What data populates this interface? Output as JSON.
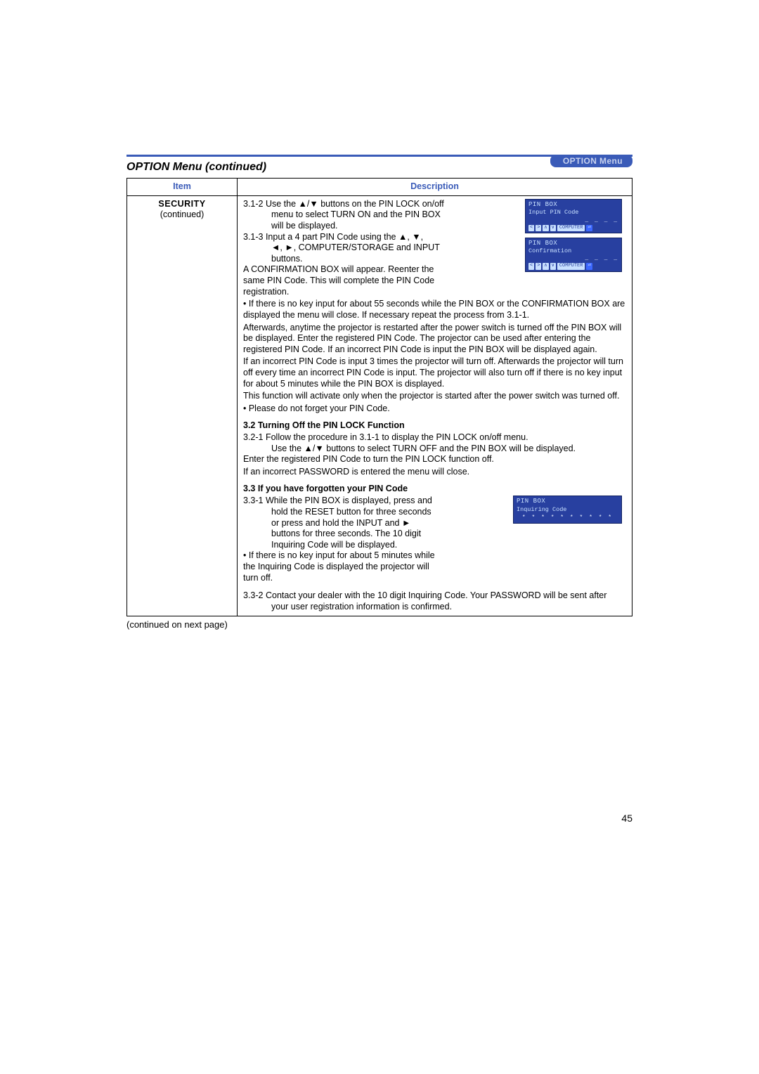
{
  "header": {
    "breadcrumb": "OPTION Menu"
  },
  "section_title": "OPTION Menu (continued)",
  "table": {
    "head_item": "Item",
    "head_desc": "Description",
    "item_name": "SECURITY",
    "item_sub": "(continued)"
  },
  "desc": {
    "l312a": "3.1-2  Use the ▲/▼ buttons on the PIN LOCK on/off",
    "l312b": "menu to select TURN ON and the PIN BOX will be displayed.",
    "l313a": "3.1-3  Input a 4 part PIN Code using the ▲, ▼,",
    "l313b": "◄, ►, COMPUTER/STORAGE and INPUT buttons.",
    "conf1": "A CONFIRMATION BOX will appear. Reenter the same PIN Code. This will complete the PIN Code registration.",
    "bul1": "• If there is no key input for about 55 seconds while the PIN BOX or the CONFIRMATION BOX are displayed the menu will close. If necessary repeat the process from 3.1-1.",
    "after": "Afterwards, anytime the projector is restarted after the power switch is turned off the PIN BOX will be displayed. Enter the registered PIN Code. The projector can be used after entering the registered PIN Code. If an incorrect PIN Code is input the PIN BOX will be displayed again.",
    "incorrect": "If an incorrect PIN Code is input 3 times the projector will turn off. Afterwards the projector will turn off every time an incorrect PIN Code is input. The projector will also turn off if there is no key input for about 5 minutes while the PIN BOX is displayed.",
    "activate": "This function will activate only when the projector is started after the power switch was turned off.",
    "forget": "• Please do not forget your PIN Code.",
    "h32": "3.2 Turning Off the PIN LOCK Function",
    "l321a": "3.2-1  Follow the procedure in 3.1-1 to display the PIN LOCK on/off menu.",
    "l321b": "Use the ▲/▼ buttons to select TURN OFF and the PIN BOX will be displayed.",
    "enter_off": "Enter the registered PIN Code to turn the PIN LOCK function off.",
    "wrong_pw": "If an incorrect PASSWORD is entered the menu will close.",
    "h33": "3.3 If you have forgotten your PIN Code",
    "l331a": "3.3-1  While the PIN BOX is displayed, press and",
    "l331b": "hold the RESET button for three seconds or press and hold the INPUT and ► buttons for three seconds. The 10 digit Inquiring Code will be displayed.",
    "bul33": "• If there is no key input for about 5 minutes while the Inquiring Code is displayed the projector will turn off.",
    "l332": "3.3-2  Contact your dealer with the 10 digit Inquiring Code. Your PASSWORD will be sent after your user registration information is confirmed."
  },
  "fig": {
    "pin_title": "PIN BOX",
    "pin_sub": "Input PIN Code",
    "conf_sub": "Confirmation",
    "dashes": "_ _ _ _",
    "key_l": "<",
    "key_r": ">",
    "key_u": "∧",
    "key_d": "∨",
    "key_comp": "COMPUTER",
    "key_enter": "⏎",
    "inq_sub": "Inquiring Code",
    "inq_code": "* *   * * * *   * * * *"
  },
  "continued": "(continued on next page)",
  "pagenum": "45"
}
